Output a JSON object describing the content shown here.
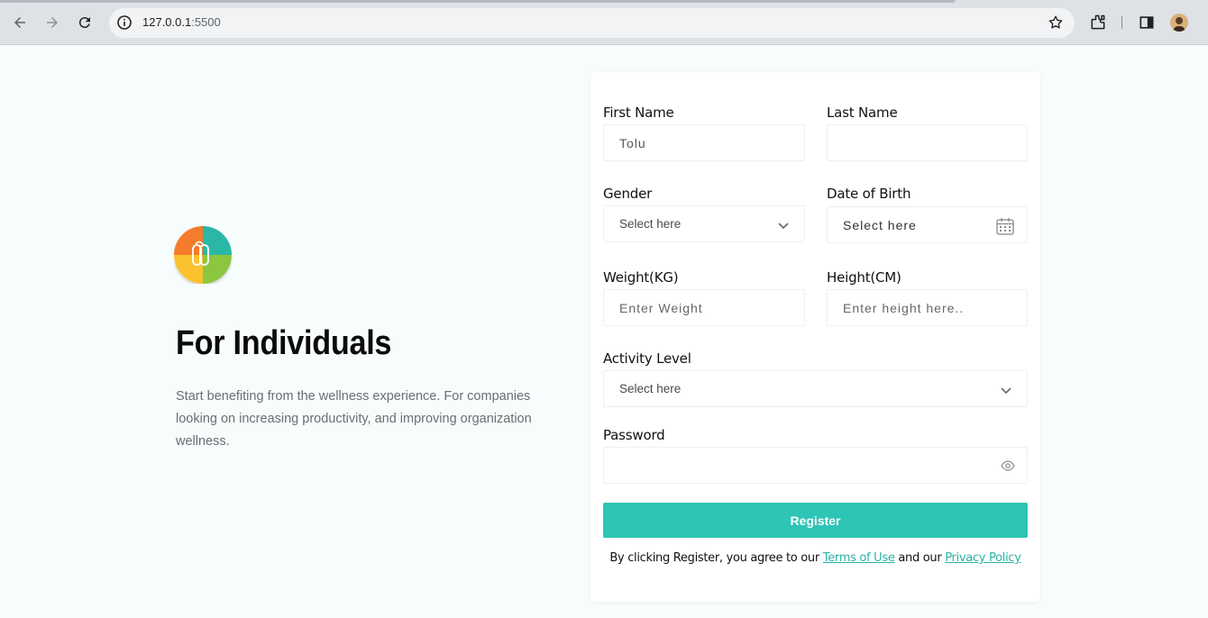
{
  "browser": {
    "url_host": "127.0.0.1",
    "url_port": ":5500"
  },
  "hero": {
    "title": "For Individuals",
    "description": "Start benefiting from the wellness experience. For companies looking on increasing productivity, and improving organization wellness."
  },
  "form": {
    "first_name": {
      "label": "First Name",
      "value": "Tolu",
      "placeholder": ""
    },
    "last_name": {
      "label": "Last Name",
      "value": "",
      "placeholder": ""
    },
    "gender": {
      "label": "Gender",
      "selected": "Select here"
    },
    "dob": {
      "label": "Date of Birth",
      "placeholder": "Select here"
    },
    "weight": {
      "label": "Weight(KG)",
      "placeholder": "Enter Weight"
    },
    "height": {
      "label": "Height(CM)",
      "placeholder": "Enter height here.."
    },
    "activity": {
      "label": "Activity Level",
      "selected": "Select here"
    },
    "password": {
      "label": "Password",
      "placeholder": ""
    },
    "register_label": "Register",
    "terms_prefix": "By clicking Register, you agree to our ",
    "terms_link": "Terms of Use",
    "terms_middle": " and our ",
    "privacy_link": "Privacy Policy"
  },
  "colors": {
    "accent": "#2ec4b6",
    "background": "#f7fcfc"
  }
}
